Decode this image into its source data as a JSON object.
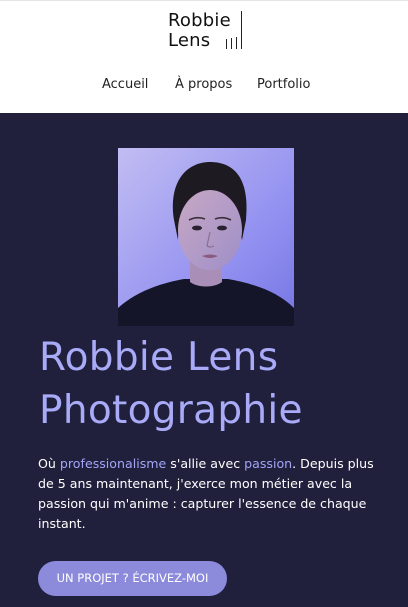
{
  "header": {
    "logo": {
      "line1": "Robbie",
      "line2": "Lens"
    },
    "nav": [
      {
        "label": "Accueil"
      },
      {
        "label": "À propos"
      },
      {
        "label": "Portfolio"
      }
    ]
  },
  "hero": {
    "title_line1": "Robbie Lens",
    "title_line2": "Photographie",
    "intro": {
      "p1": "Où ",
      "h1": "professionalisme",
      "p2": " s'allie avec ",
      "h2": "passion",
      "p3": ". Depuis plus de 5 ans maintenant, j'exerce mon métier avec la passion qui m'anime : capturer l'essence de chaque instant."
    },
    "cta_label": "UN PROJET ? ÉCRIVEZ-MOI"
  },
  "colors": {
    "hero_background": "#20203d",
    "accent": "#a9aaf8",
    "button": "#8c8adb",
    "header_background": "#ffffff"
  }
}
